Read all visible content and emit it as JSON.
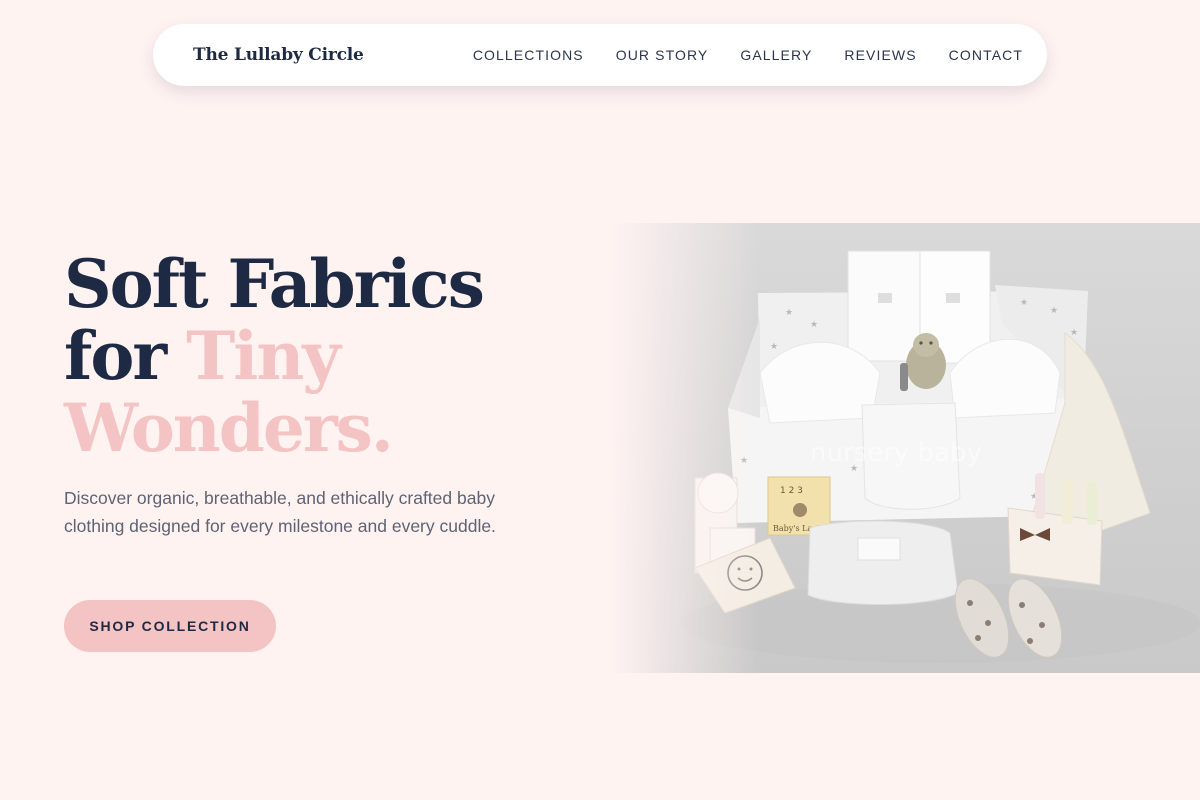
{
  "nav": {
    "brand": "The Lullaby Circle",
    "links": [
      {
        "label": "COLLECTIONS"
      },
      {
        "label": "OUR STORY"
      },
      {
        "label": "GALLERY"
      },
      {
        "label": "REVIEWS"
      },
      {
        "label": "CONTACT"
      }
    ]
  },
  "hero": {
    "headline_part1": "Soft Fabrics",
    "headline_part2": "for",
    "headline_accent": "Tiny Wonders.",
    "description": "Discover organic, breathable, and ethically crafted baby clothing designed for every milestone and every cuddle.",
    "cta_label": "SHOP COLLECTION",
    "image": {
      "alt": "Baby gift box with clothing and accessories",
      "watermark_text": "nursery baby",
      "book_title": "Baby's Last",
      "book_numbers": "1 2 3"
    }
  },
  "colors": {
    "background": "#fff3f2",
    "navy": "#1e2a44",
    "accent_pink": "#f4c3c3",
    "body_text": "#5e6373",
    "nav_bg": "#ffffff"
  }
}
